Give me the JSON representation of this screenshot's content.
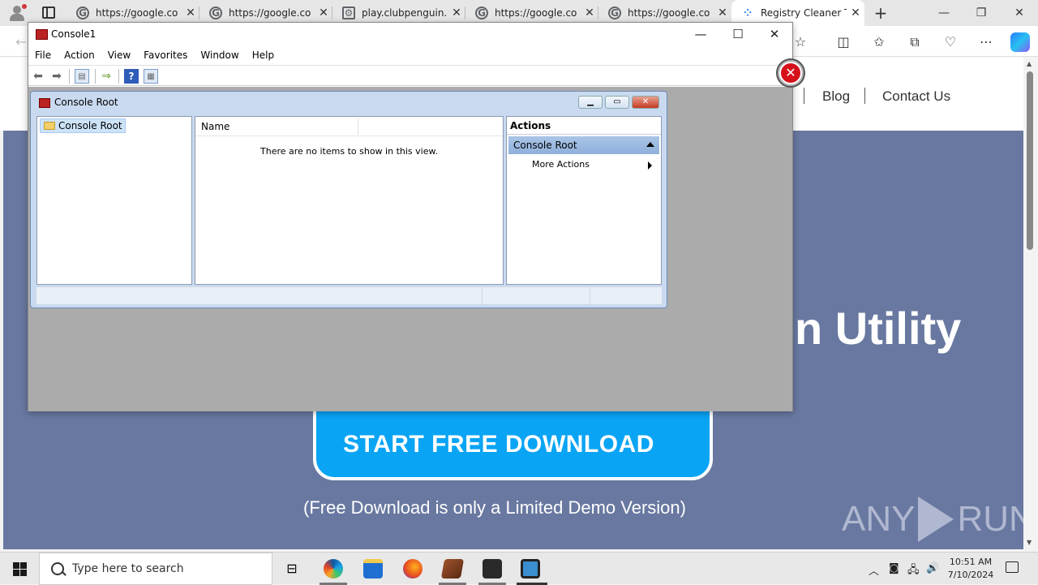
{
  "browser": {
    "tabs": [
      {
        "title": "https://google.co",
        "icon": "google-icon"
      },
      {
        "title": "https://google.co",
        "icon": "google-icon"
      },
      {
        "title": "play.clubpenguin.",
        "icon": "page-icon"
      },
      {
        "title": "https://google.co",
        "icon": "google-icon"
      },
      {
        "title": "https://google.co",
        "icon": "google-icon"
      },
      {
        "title": "Registry Cleaner To",
        "icon": "loading-icon",
        "active": true
      }
    ],
    "new_tab": "+",
    "minimize": "—",
    "restore": "❐",
    "close": "✕"
  },
  "site": {
    "nav": {
      "blog": "Blog",
      "contact": "Contact Us"
    },
    "hero_title_fragment": "n Utility",
    "download_button": "START FREE DOWNLOAD",
    "download_note": "(Free Download is only a Limited Demo Version)",
    "watermark": {
      "left": "ANY",
      "right": "RUN"
    },
    "hero_bg": "#6878a0",
    "button_color": "#0aa4f5"
  },
  "mmc": {
    "title": "Console1",
    "menu": [
      "File",
      "Action",
      "View",
      "Favorites",
      "Window",
      "Help"
    ],
    "child": {
      "title": "Console Root",
      "tree_item": "Console Root",
      "list_column": "Name",
      "empty_message": "There are no items to show in this view.",
      "actions_header": "Actions",
      "actions_section": "Console Root",
      "actions_item": "More Actions"
    }
  },
  "taskbar": {
    "search_placeholder": "Type here to search",
    "time": "10:51 AM",
    "date": "7/10/2024"
  }
}
